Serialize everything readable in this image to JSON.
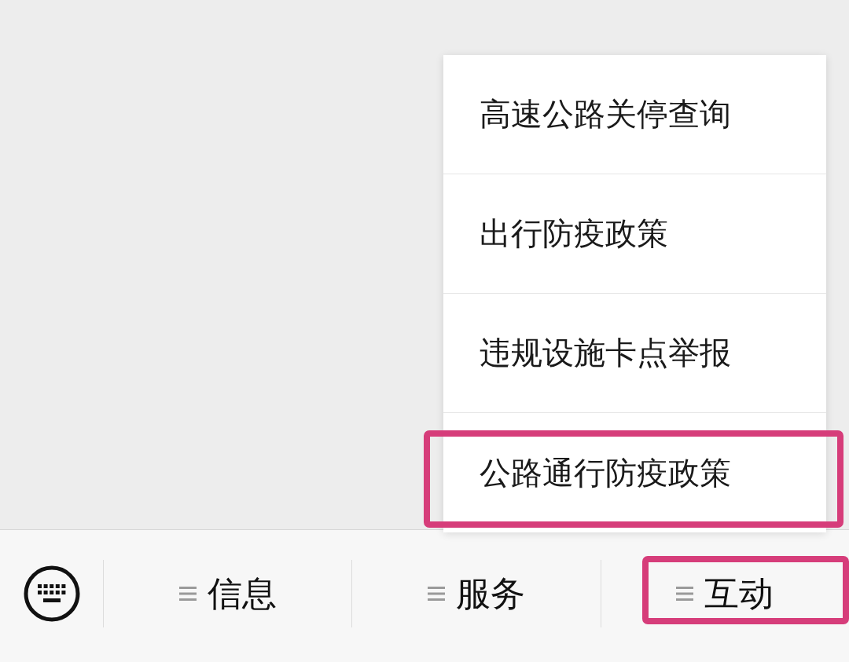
{
  "menu": {
    "items": [
      {
        "label": "高速公路关停查询",
        "highlighted": false
      },
      {
        "label": "出行防疫政策",
        "highlighted": false
      },
      {
        "label": "违规设施卡点举报",
        "highlighted": false
      },
      {
        "label": "公路通行防疫政策",
        "highlighted": true
      }
    ]
  },
  "bottom_bar": {
    "tabs": [
      {
        "label": "信息",
        "highlighted": false
      },
      {
        "label": "服务",
        "highlighted": false
      },
      {
        "label": "互动",
        "highlighted": true
      }
    ]
  }
}
